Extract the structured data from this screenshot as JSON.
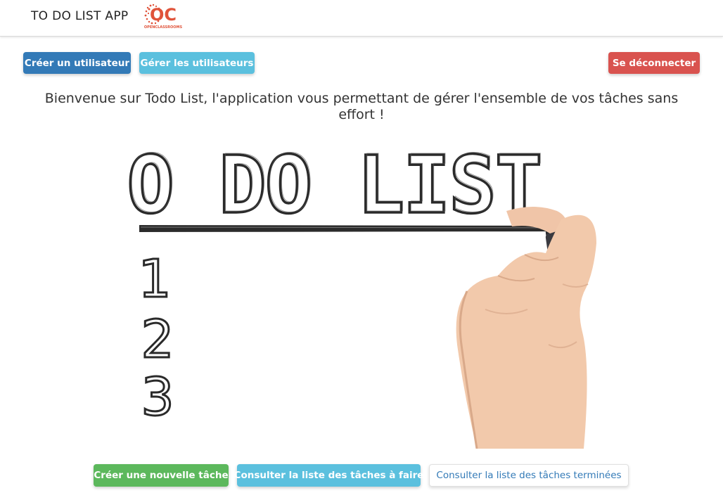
{
  "navbar": {
    "brand": "TO DO LIST APP",
    "logo_text": "OPENCLASSROOMS",
    "logo_mark": "OC"
  },
  "actions": {
    "create_user": "Créer un utilisateur",
    "manage_users": "Gérer les utilisateurs",
    "logout": "Se déconnecter"
  },
  "welcome_text": "Bienvenue sur Todo List, l'application vous permettant de gérer l'ensemble de vos tâches sans effort !",
  "hero": {
    "title": "TO DO LIST",
    "numbers": [
      "1",
      "2",
      "3"
    ]
  },
  "task_actions": {
    "new_task": "Créer une nouvelle tâche",
    "todo_list": "Consulter la liste des tâches à faire",
    "done_list": "Consulter la liste des tâches terminées"
  },
  "colors": {
    "primary": "#337ab7",
    "info": "#5bc0de",
    "danger": "#d9534f",
    "success": "#5cb85c",
    "logo": "#e0533a"
  },
  "icons": [
    "openclassrooms-logo",
    "hand-marker-illustration"
  ]
}
